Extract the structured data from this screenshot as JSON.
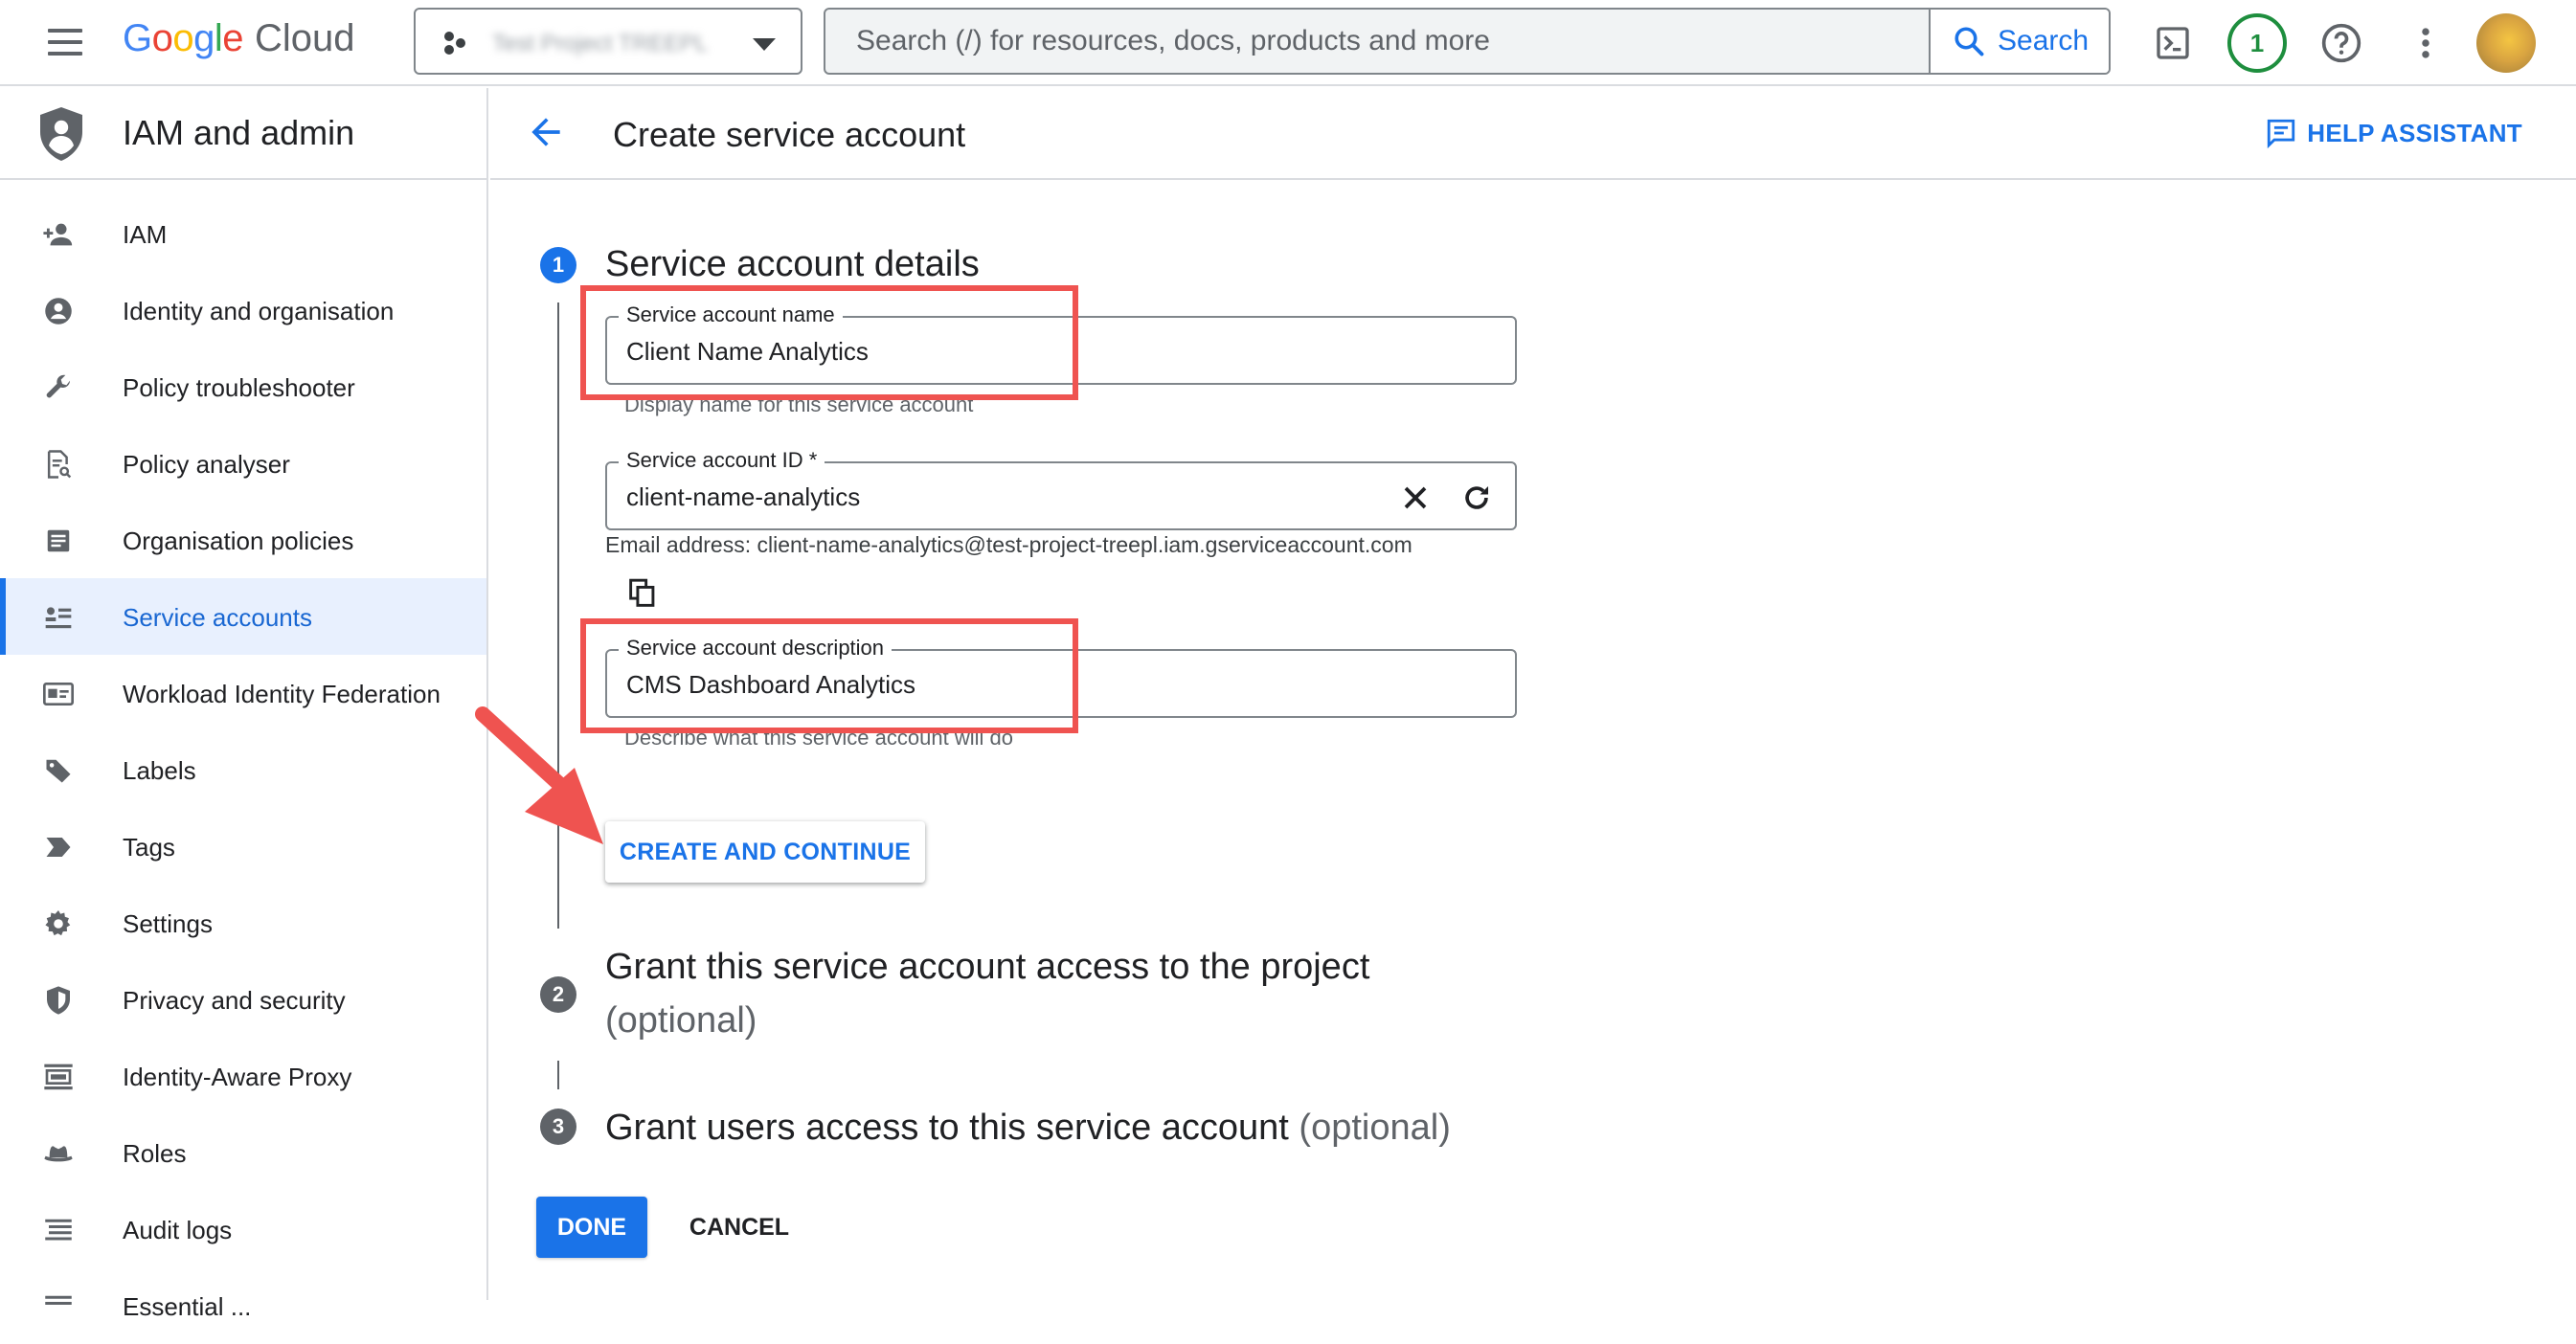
{
  "topbar": {
    "logo_google": "Google",
    "logo_cloud": "Cloud",
    "project_name": "Test Project TREEPL",
    "search_placeholder": "Search (/) for resources, docs, products and more",
    "search_button": "Search",
    "notification_count": "1"
  },
  "sidebar": {
    "title": "IAM and admin",
    "items": [
      {
        "label": "IAM",
        "icon": "person-add-icon"
      },
      {
        "label": "Identity and organisation",
        "icon": "account-circle-icon"
      },
      {
        "label": "Policy troubleshooter",
        "icon": "wrench-icon"
      },
      {
        "label": "Policy analyser",
        "icon": "document-search-icon"
      },
      {
        "label": "Organisation policies",
        "icon": "policy-document-icon"
      },
      {
        "label": "Service accounts",
        "icon": "service-account-icon",
        "active": true
      },
      {
        "label": "Workload Identity Federation",
        "icon": "id-card-icon"
      },
      {
        "label": "Labels",
        "icon": "label-icon"
      },
      {
        "label": "Tags",
        "icon": "tag-icon"
      },
      {
        "label": "Settings",
        "icon": "gear-icon"
      },
      {
        "label": "Privacy and security",
        "icon": "shield-icon"
      },
      {
        "label": "Identity-Aware Proxy",
        "icon": "proxy-icon"
      },
      {
        "label": "Roles",
        "icon": "hat-icon"
      },
      {
        "label": "Audit logs",
        "icon": "list-icon"
      },
      {
        "label": "Essential ...",
        "icon": "more-icon"
      }
    ]
  },
  "header": {
    "title": "Create service account",
    "help_assistant": "HELP ASSISTANT"
  },
  "steps": [
    {
      "number": "1",
      "title": "Service account details",
      "optional": ""
    },
    {
      "number": "2",
      "title": "Grant this service account access to the project",
      "optional": "(optional)"
    },
    {
      "number": "3",
      "title": "Grant users access to this service account",
      "optional": "(optional)"
    }
  ],
  "form": {
    "name_label": "Service account name",
    "name_value": "Client Name Analytics",
    "name_hint": "Display name for this service account",
    "id_label": "Service account ID *",
    "id_value": "client-name-analytics",
    "email_text": "Email address: client-name-analytics@test-project-treepl.iam.gserviceaccount.com",
    "description_label": "Service account description",
    "description_value": "CMS Dashboard Analytics",
    "description_hint": "Describe what this service account will do",
    "create_button": "CREATE AND CONTINUE"
  },
  "footer": {
    "done_button": "DONE",
    "cancel_button": "CANCEL"
  },
  "colors": {
    "accent": "#1a73e8",
    "highlight": "#ef5350",
    "active_nav_bg": "#e8f0fe"
  }
}
